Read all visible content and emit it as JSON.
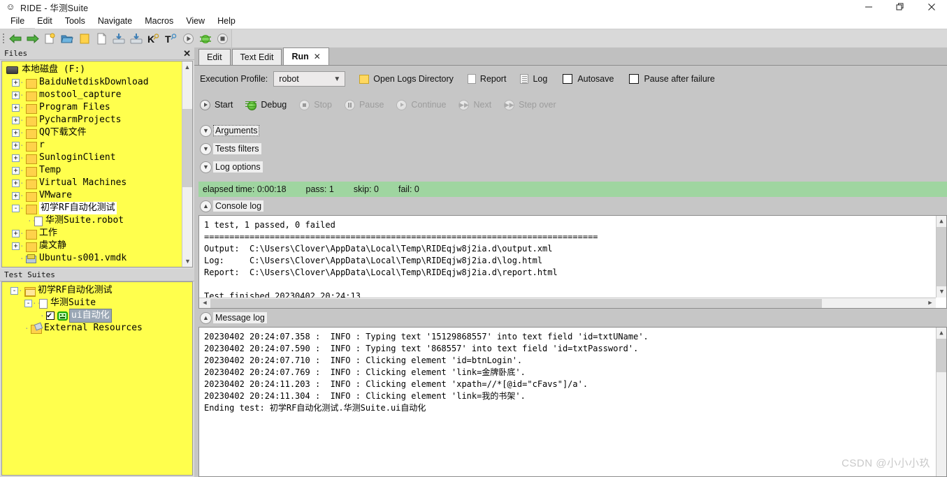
{
  "window": {
    "title": "RIDE - 华测Suite",
    "app_icon": "ride-icon",
    "minimize": "–",
    "restore": "❐",
    "close": "✕"
  },
  "menubar": {
    "items": [
      "File",
      "Edit",
      "Tools",
      "Navigate",
      "Macros",
      "View",
      "Help"
    ]
  },
  "toolbar": {
    "buttons": [
      {
        "name": "back-arrow-icon",
        "glyph": "◀"
      },
      {
        "name": "forward-arrow-icon",
        "glyph": "▶"
      },
      {
        "name": "new-project-icon",
        "glyph": "🗋"
      },
      {
        "name": "open-folder-icon",
        "glyph": "📂"
      },
      {
        "name": "folder-icon",
        "glyph": "📁"
      },
      {
        "name": "new-file-icon",
        "glyph": "🗎"
      },
      {
        "name": "save-icon",
        "glyph": "💾"
      },
      {
        "name": "save-all-icon",
        "glyph": "💾"
      },
      {
        "name": "search-keyword-icon",
        "glyph": "K"
      },
      {
        "name": "search-test-icon",
        "glyph": "T"
      },
      {
        "name": "run-icon",
        "glyph": "▶"
      },
      {
        "name": "debug-icon",
        "glyph": "🐞"
      },
      {
        "name": "stop-icon",
        "glyph": "■"
      }
    ]
  },
  "files_panel": {
    "title": "Files",
    "close_label": "✕",
    "root": "本地磁盘 (F:)",
    "items": [
      {
        "label": "BaiduNetdiskDownload",
        "type": "folder",
        "expander": "+",
        "indent": 1,
        "selected": false
      },
      {
        "label": "mostool_capture",
        "type": "folder",
        "expander": "+",
        "indent": 1,
        "selected": false
      },
      {
        "label": "Program Files",
        "type": "folder",
        "expander": "+",
        "indent": 1,
        "selected": false
      },
      {
        "label": "PycharmProjects",
        "type": "folder",
        "expander": "+",
        "indent": 1,
        "selected": false
      },
      {
        "label": "QQ下载文件",
        "type": "folder",
        "expander": "+",
        "indent": 1,
        "selected": false
      },
      {
        "label": "r",
        "type": "folder",
        "expander": "+",
        "indent": 1,
        "selected": false
      },
      {
        "label": "SunloginClient",
        "type": "folder",
        "expander": "+",
        "indent": 1,
        "selected": false
      },
      {
        "label": "Temp",
        "type": "folder",
        "expander": "+",
        "indent": 1,
        "selected": false
      },
      {
        "label": "Virtual Machines",
        "type": "folder",
        "expander": "+",
        "indent": 1,
        "selected": false
      },
      {
        "label": "VMware",
        "type": "folder",
        "expander": "+",
        "indent": 1,
        "selected": false
      },
      {
        "label": "初学RF自动化测试",
        "type": "folder",
        "expander": "-",
        "indent": 1,
        "selected": true
      },
      {
        "label": "华测Suite.robot",
        "type": "file",
        "expander": "",
        "indent": 2,
        "selected": false
      },
      {
        "label": "工作",
        "type": "folder",
        "expander": "+",
        "indent": 1,
        "selected": false
      },
      {
        "label": "虞文静",
        "type": "folder",
        "expander": "+",
        "indent": 1,
        "selected": false
      },
      {
        "label": "Ubuntu-s001.vmdk",
        "type": "vmdk",
        "expander": "",
        "indent": 1,
        "selected": false
      }
    ]
  },
  "test_suites_panel": {
    "title": "Test Suites",
    "items": [
      {
        "label": "初学RF自动化测试",
        "type": "folder-open",
        "expander": "-",
        "indent": 0,
        "checkbox": null,
        "selected": false
      },
      {
        "label": "华测Suite",
        "type": "file",
        "expander": "-",
        "indent": 1,
        "checkbox": null,
        "selected": false
      },
      {
        "label": "ui自动化",
        "type": "robot",
        "expander": "",
        "indent": 2,
        "checkbox": "checked",
        "selected": true
      },
      {
        "label": "External Resources",
        "type": "resources",
        "expander": "",
        "indent": 1,
        "checkbox": null,
        "selected": false
      }
    ]
  },
  "editor_tabs": [
    {
      "label": "Edit",
      "active": false,
      "closable": false
    },
    {
      "label": "Text Edit",
      "active": false,
      "closable": false
    },
    {
      "label": "Run",
      "active": true,
      "closable": true,
      "close_glyph": "✕"
    }
  ],
  "run_pane": {
    "profile_label": "Execution Profile:",
    "profile_value": "robot",
    "profile_chevron": "⌄",
    "open_logs_label": "Open Logs Directory",
    "report_label": "Report",
    "log_label": "Log",
    "autosave_label": "Autosave",
    "autosave_checked": false,
    "pause_after_failure_label": "Pause after failure",
    "pause_after_failure_checked": false,
    "controls": [
      {
        "label": "Start",
        "icon": "play-icon",
        "enabled": true
      },
      {
        "label": "Debug",
        "icon": "bug-icon",
        "enabled": true
      },
      {
        "label": "Stop",
        "icon": "stop-icon",
        "enabled": false
      },
      {
        "label": "Pause",
        "icon": "pause-icon",
        "enabled": false
      },
      {
        "label": "Continue",
        "icon": "play-icon",
        "enabled": false
      },
      {
        "label": "Next",
        "icon": "next-icon",
        "enabled": false
      },
      {
        "label": "Step over",
        "icon": "step-over-icon",
        "enabled": false
      }
    ],
    "sections": [
      {
        "label": "Arguments",
        "expanded": false,
        "focused": true,
        "chevron": "⌄"
      },
      {
        "label": "Tests filters",
        "expanded": false,
        "focused": false,
        "chevron": "⌄"
      },
      {
        "label": "Log options",
        "expanded": false,
        "focused": false,
        "chevron": "⌄"
      }
    ],
    "status": {
      "elapsed": "elapsed time: 0:00:18",
      "pass": "pass: 1",
      "skip": "skip: 0",
      "fail": "fail: 0",
      "color": "#9fd5a0"
    },
    "console_log": {
      "title": "Console log",
      "chevron": "⌃",
      "text": "1 test, 1 passed, 0 failed\n==============================================================================\nOutput:  C:\\Users\\Clover\\AppData\\Local\\Temp\\RIDEqjw8j2ia.d\\output.xml\nLog:     C:\\Users\\Clover\\AppData\\Local\\Temp\\RIDEqjw8j2ia.d\\log.html\nReport:  C:\\Users\\Clover\\AppData\\Local\\Temp\\RIDEqjw8j2ia.d\\report.html\n\nTest finished 20230402 20:24:13"
    },
    "message_log": {
      "title": "Message log",
      "chevron": "⌃",
      "text": "20230402 20:24:07.358 :  INFO : Typing text '15129868557' into text field 'id=txtUName'.\n20230402 20:24:07.590 :  INFO : Typing text '868557' into text field 'id=txtPassword'.\n20230402 20:24:07.710 :  INFO : Clicking element 'id=btnLogin'.\n20230402 20:24:07.769 :  INFO : Clicking element 'link=金牌卧底'.\n20230402 20:24:11.203 :  INFO : Clicking element 'xpath=//*[@id=\"cFavs\"]/a'.\n20230402 20:24:11.304 :  INFO : Clicking element 'link=我的书架'.\nEnding test: 初学RF自动化测试.华测Suite.ui自动化"
    }
  },
  "watermark": "CSDN @小小小玖"
}
